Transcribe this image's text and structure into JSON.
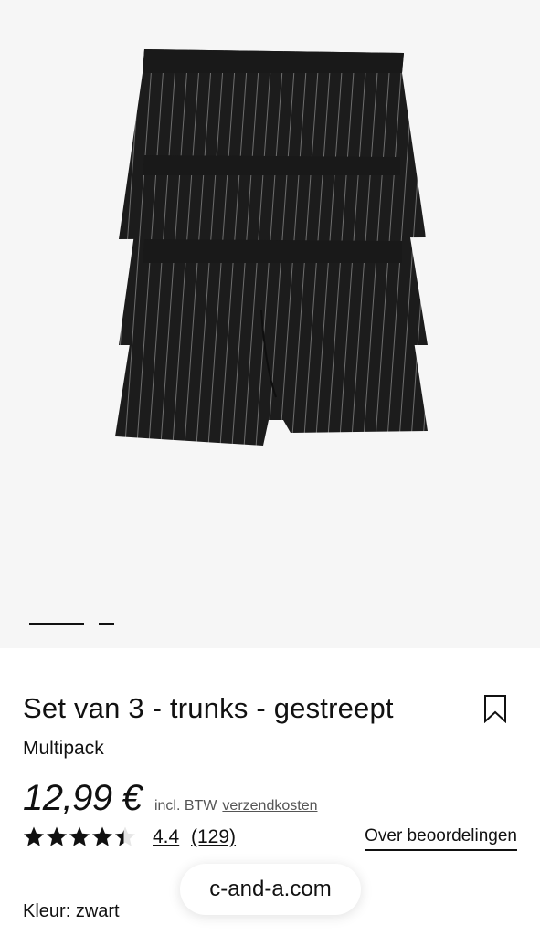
{
  "gallery": {
    "product_image_alt": "black striped trunks 3-pack",
    "page_indicator": {
      "active": 1,
      "total": 2
    }
  },
  "product": {
    "title": "Set van 3 - trunks - gestreept",
    "subtitle": "Multipack",
    "price": "12,99 €",
    "vat_note": "incl. BTW",
    "shipping_link": "verzendkosten",
    "rating_value": "4.4",
    "rating_count": "(129)",
    "rating_stars": 4.4,
    "reviews_link": "Over beoordelingen",
    "color_label": "Kleur:",
    "color_value": "zwart"
  },
  "browser": {
    "url": "c-and-a.com"
  },
  "icons": {
    "bookmark": "bookmark-icon",
    "star": "star-icon"
  },
  "colors": {
    "text": "#111111",
    "gallery_bg": "#f6f6f6",
    "product": "#1c1c1c",
    "stripe": "#6e6e6e"
  }
}
